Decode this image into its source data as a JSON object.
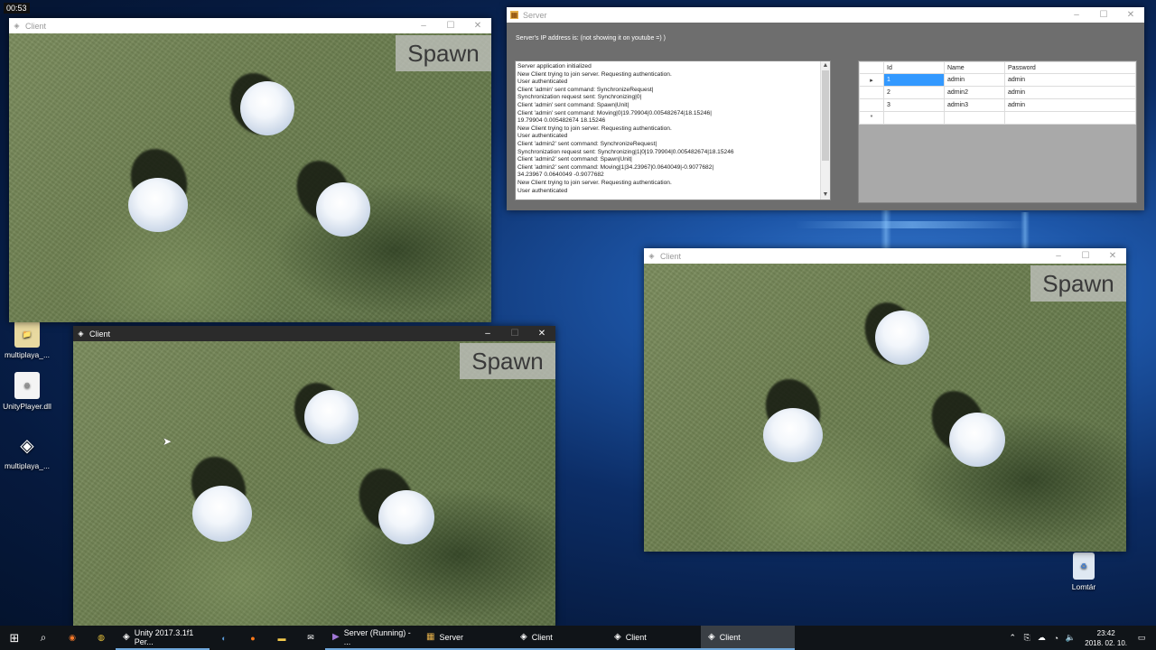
{
  "top_left_clock": "00:53",
  "desktop_icons": [
    {
      "label": "multiplaya_...",
      "icon": "folder-icon"
    },
    {
      "label": "UnityPlayer.dll",
      "icon": "dll-file-icon"
    },
    {
      "label": "multiplaya_...",
      "icon": "unity-icon"
    },
    {
      "label": "Lomtár",
      "icon": "recycle-bin-icon"
    }
  ],
  "client_windows": [
    {
      "title": "Client",
      "spawn_label": "Spawn"
    },
    {
      "title": "Client",
      "spawn_label": "Spawn"
    },
    {
      "title": "Client",
      "spawn_label": "Spawn"
    }
  ],
  "server": {
    "title": "Server",
    "ip_text": "Server's IP address is:  (not showing it on youtube =) )",
    "log_lines": [
      "Server application initialized",
      "New Client trying to join server. Requesting authentication.",
      "User authenticated",
      "Client 'admin' sent command: SynchronizeRequest|",
      "Synchronization request sent: Synchronizing|0|",
      "Client 'admin' sent command: Spawn|Unit|",
      "Client 'admin' sent command: Moving|0|19.79904|0.005482674|18.15246|",
      "19.79904  0.005482674  18.15246",
      "New Client trying to join server. Requesting authentication.",
      "User authenticated",
      "Client 'admin2' sent command: SynchronizeRequest|",
      "Synchronization request sent: Synchronizing|1|0|19.79904|0.005482674|18.15246",
      "Client 'admin2' sent command: Spawn|Unit|",
      "Client 'admin2' sent command: Moving|1|34.23967|0.0640049|-0.9077682|",
      "34.23967  0.0640049  -0.9077682",
      "New Client trying to join server. Requesting authentication.",
      "User authenticated"
    ],
    "grid": {
      "columns": [
        "Id",
        "Name",
        "Password"
      ],
      "rows": [
        {
          "id": "1",
          "name": "admin",
          "password": "admin"
        },
        {
          "id": "2",
          "name": "admin2",
          "password": "admin"
        },
        {
          "id": "3",
          "name": "admin3",
          "password": "admin"
        }
      ],
      "new_row_marker": "*",
      "current_row_marker": "▸"
    }
  },
  "taskbar": {
    "tasks": [
      {
        "label": "Unity 2017.3.1f1 Per...",
        "icon": "unity-icon"
      },
      {
        "label": "Server (Running) - ...",
        "icon": "visual-studio-icon"
      },
      {
        "label": "Server",
        "icon": "server-app-icon"
      },
      {
        "label": "Client",
        "icon": "unity-icon"
      },
      {
        "label": "Client",
        "icon": "unity-icon"
      },
      {
        "label": "Client",
        "icon": "unity-icon"
      }
    ],
    "time": "23:42",
    "date": "2018. 02. 10."
  }
}
